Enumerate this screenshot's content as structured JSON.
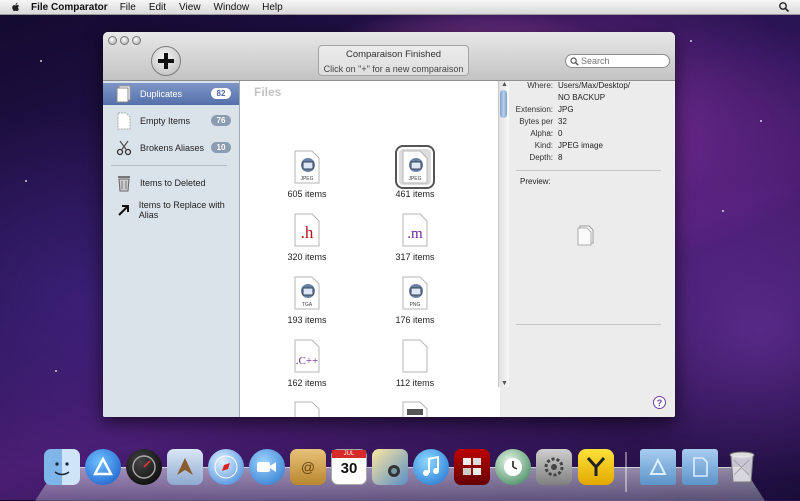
{
  "menubar": {
    "app_name": "File Comparator",
    "items": [
      "File",
      "Edit",
      "View",
      "Window",
      "Help"
    ]
  },
  "window": {
    "status_line1": "Comparaison Finished",
    "status_line2": "Click on \"+\" for a new comparaison",
    "search_placeholder": "Search"
  },
  "sidebar": {
    "items": [
      {
        "label": "Duplicates",
        "count": "82"
      },
      {
        "label": "Empty Items",
        "count": "76"
      },
      {
        "label": "Brokens Aliases",
        "count": "10"
      },
      {
        "label": "Items to Deleted"
      },
      {
        "label": "Items to Replace with Alias"
      }
    ]
  },
  "files": {
    "title": "Files",
    "grid": [
      {
        "label": "605 items",
        "icon": "jpeg-file-icon",
        "badge": "JPEG"
      },
      {
        "label": "461 items",
        "icon": "jpeg-file-icon",
        "badge": "JPEG"
      },
      {
        "label": "320 items",
        "icon": "h-file-icon",
        "badge": ".h"
      },
      {
        "label": "317 items",
        "icon": "m-file-icon",
        "badge": ".m"
      },
      {
        "label": "193 items",
        "icon": "tga-file-icon",
        "badge": "TGA"
      },
      {
        "label": "176 items",
        "icon": "png-file-icon",
        "badge": "PNG"
      },
      {
        "label": "162 items",
        "icon": "cpp-file-icon",
        "badge": ".c++"
      },
      {
        "label": "112 items",
        "icon": "blank-file-icon",
        "badge": ""
      }
    ]
  },
  "info": {
    "where_label": "Where:",
    "where_value": "Users/Max/Desktop/",
    "where_value2": "NO BACKUP",
    "extension_label": "Extension:",
    "extension_value": "JPG",
    "bytes_label": "Bytes per ...",
    "bytes_value": "32",
    "alpha_label": "Alpha:",
    "alpha_value": "0",
    "kind_label": "Kind:",
    "kind_value": "JPEG image",
    "depth_label": "Depth:",
    "depth_value": "8",
    "preview_label": "Preview:",
    "help": "?"
  },
  "dock": {
    "apps": [
      "finder-icon",
      "app-store-icon",
      "dashboard-icon",
      "mail-icon",
      "safari-icon",
      "facetime-icon",
      "address-book-icon",
      "ical-icon",
      "iphoto-icon",
      "itunes-icon",
      "photo-booth-icon",
      "time-machine-icon",
      "system-preferences-icon",
      "file-comparator-icon",
      "applications-folder-icon",
      "documents-folder-icon",
      "trash-icon"
    ],
    "ical_month": "JUL",
    "ical_day": "30"
  },
  "colors": {
    "selection": "#5470ac",
    "sidebar_bg": "#dbe3ea"
  }
}
